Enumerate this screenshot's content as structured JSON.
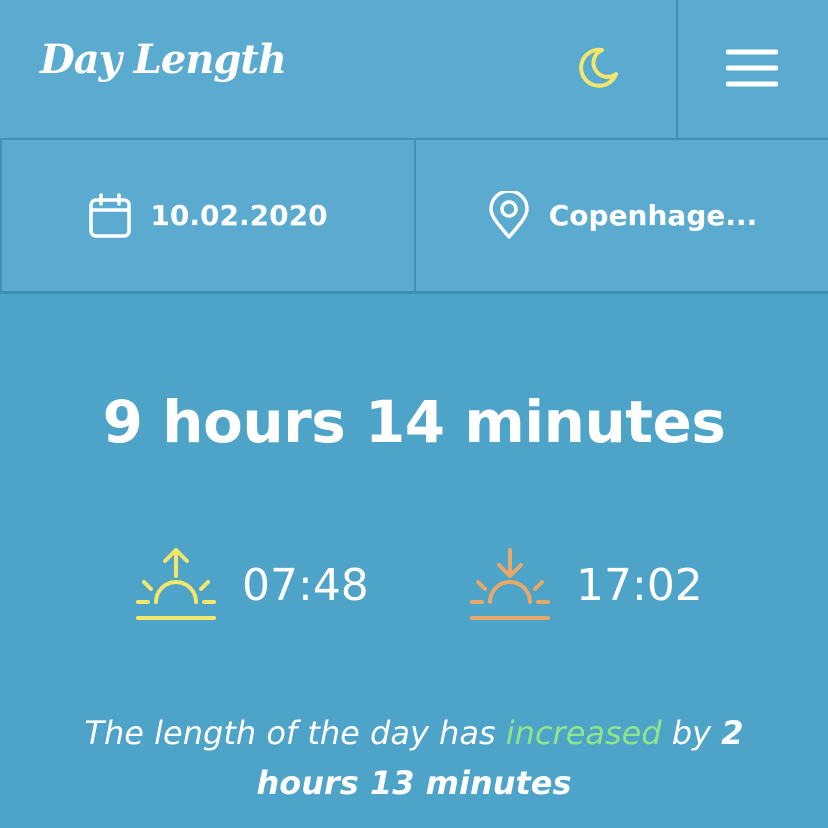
{
  "header": {
    "title": "Day Length",
    "theme_icon": "moon-icon",
    "menu_icon": "hamburger-menu-icon",
    "theme_icon_color": "#f4e66c"
  },
  "selectors": {
    "date": {
      "icon": "calendar-icon",
      "value": "10.02.2020"
    },
    "location": {
      "icon": "location-pin-icon",
      "value": "Copenhage..."
    }
  },
  "day_length": "9 hours 14 minutes",
  "sunrise": {
    "icon": "sunrise-icon",
    "time": "07:48",
    "color": "#f4e66c"
  },
  "sunset": {
    "icon": "sunset-icon",
    "time": "17:02",
    "color": "#e8a868"
  },
  "summary": {
    "prefix": "The length of the day has ",
    "change_word": "increased",
    "middle": " by ",
    "amount": "2 hours 13 minutes",
    "change_color": "#8ee68a"
  },
  "colors": {
    "background": "#4ea3c8",
    "panel": "#5aabcf",
    "divider": "#3f8fb3"
  }
}
